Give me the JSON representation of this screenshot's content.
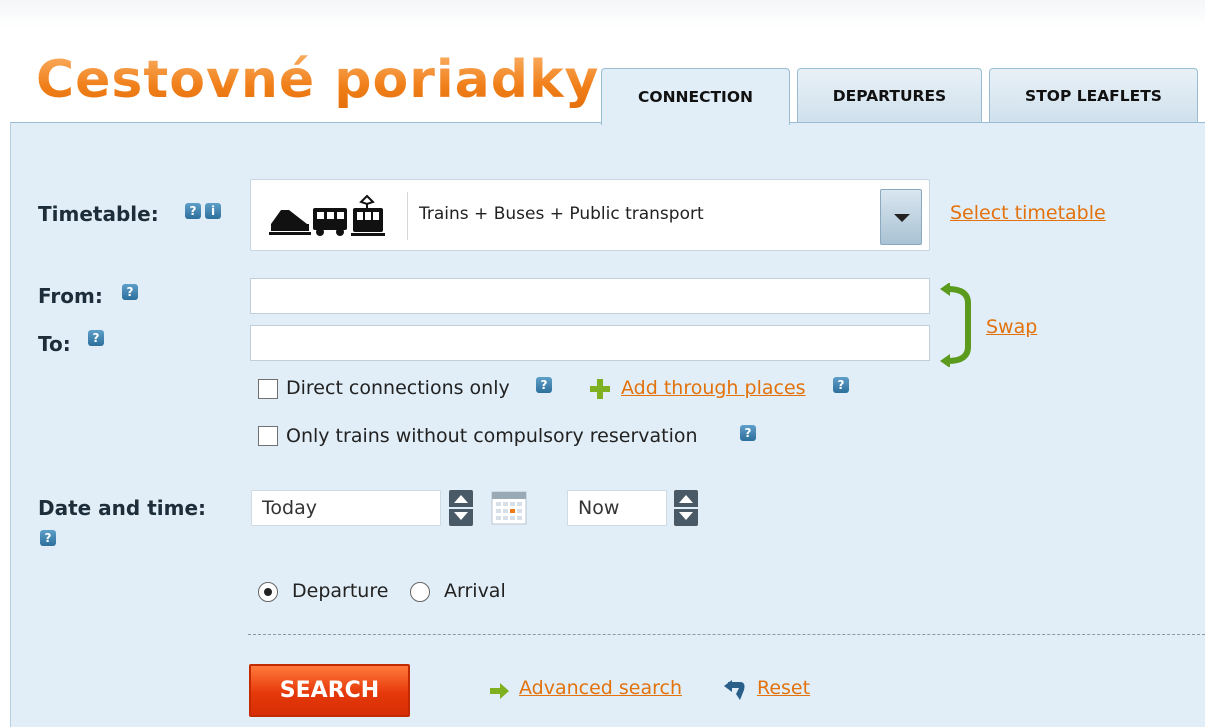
{
  "logo": {
    "text": "Cestovné poriadky"
  },
  "tabs": [
    {
      "label": "CONNECTION",
      "active": true
    },
    {
      "label": "DEPARTURES",
      "active": false
    },
    {
      "label": "STOP LEAFLETS",
      "active": false
    }
  ],
  "timetable": {
    "label": "Timetable:",
    "selected": "Trains + Buses + Public transport",
    "select_link": "Select timetable"
  },
  "route": {
    "from_label": "From:",
    "to_label": "To:",
    "from_value": "",
    "to_value": "",
    "swap_label": "Swap"
  },
  "options": {
    "direct_only": {
      "label": "Direct connections only",
      "checked": false
    },
    "add_through": "Add through places",
    "no_reservation": {
      "label": "Only trains without compulsory reservation",
      "checked": false
    }
  },
  "datetime": {
    "label": "Date and time:",
    "date_value": "Today",
    "time_value": "Now"
  },
  "mode": {
    "departure_label": "Departure",
    "arrival_label": "Arrival",
    "selected": "Departure"
  },
  "actions": {
    "search": "SEARCH",
    "advanced": "Advanced search",
    "reset": "Reset"
  },
  "icons": {
    "help": "?",
    "info": "i"
  },
  "colors": {
    "accent_orange": "#e3720c",
    "panel_bg": "#e1eef7",
    "search_btn": "#e6390a"
  }
}
